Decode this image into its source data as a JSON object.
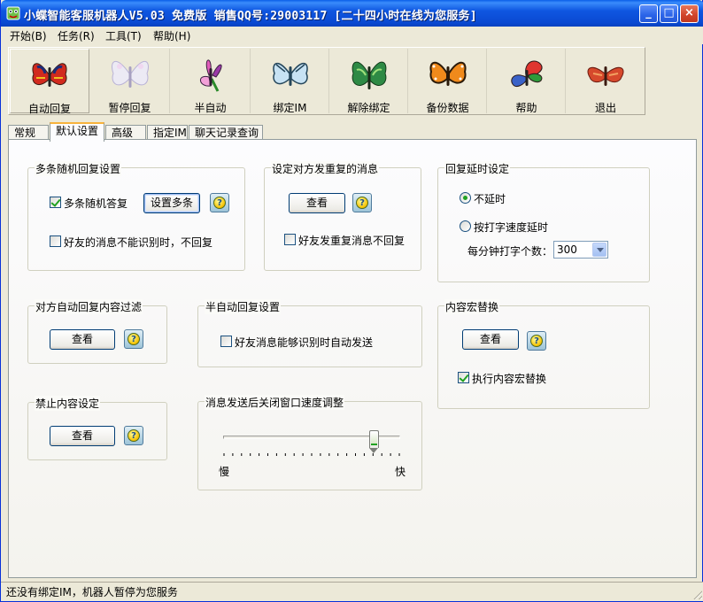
{
  "window": {
    "title": "小蝶智能客服机器人V5.03 免费版  销售QQ号:29003117 [二十四小时在线为您服务]",
    "controls": {
      "minimize": "_",
      "maximize": "□",
      "close": "×"
    }
  },
  "menu": [
    {
      "label": "开始(B)"
    },
    {
      "label": "任务(R)"
    },
    {
      "label": "工具(T)"
    },
    {
      "label": "帮助(H)"
    }
  ],
  "toolbar": [
    {
      "label": "自动回复",
      "icon": "butterfly-red-icon"
    },
    {
      "label": "暂停回复",
      "icon": "butterfly-pale-icon"
    },
    {
      "label": "半自动",
      "icon": "butterfly-pink-icon"
    },
    {
      "label": "绑定IM",
      "icon": "butterfly-blue-icon"
    },
    {
      "label": "解除绑定",
      "icon": "butterfly-green-icon"
    },
    {
      "label": "备份数据",
      "icon": "butterfly-orange-icon"
    },
    {
      "label": "帮助",
      "icon": "butterfly-colorful-icon"
    },
    {
      "label": "退出",
      "icon": "butterfly-red-orange-icon"
    }
  ],
  "tabs": [
    {
      "label": "常规"
    },
    {
      "label": "默认设置",
      "active": true
    },
    {
      "label": "高级"
    },
    {
      "label": "指定IM"
    },
    {
      "label": "聊天记录查询"
    }
  ],
  "groups": {
    "multi_reply": {
      "title": "多条随机回复设置",
      "checkbox1": "多条随机答复",
      "checkbox1_checked": true,
      "button": "设置多条",
      "checkbox2": "好友的消息不能识别时，不回复",
      "checkbox2_checked": false
    },
    "repeat_msg": {
      "title": "设定对方发重复的消息",
      "button": "查看",
      "checkbox": "好友发重复消息不回复",
      "checkbox_checked": false
    },
    "delay": {
      "title": "回复延时设定",
      "radio1": "不延时",
      "radio2": "按打字速度延时",
      "rate_label": "每分钟打字个数：",
      "rate_value": "300",
      "selected": "radio1"
    },
    "filter": {
      "title": "对方自动回复内容过滤",
      "button": "查看"
    },
    "semi_auto": {
      "title": "半自动回复设置",
      "checkbox": "好友消息能够识别时自动发送",
      "checkbox_checked": false
    },
    "macro": {
      "title": "内容宏替换",
      "button": "查看",
      "checkbox": "执行内容宏替换",
      "checkbox_checked": true
    },
    "forbidden": {
      "title": "禁止内容设定",
      "button": "查看"
    },
    "close_speed": {
      "title": "消息发送后关闭窗口速度调整",
      "slow": "慢",
      "fast": "快",
      "slider_fraction": 0.85
    }
  },
  "status": {
    "text": "还没有绑定IM，机器人暂停为您服务"
  },
  "colors": {
    "titlebar": "#0a49d2",
    "tab_accent": "#f8b33c",
    "check_mark": "#21a121"
  }
}
